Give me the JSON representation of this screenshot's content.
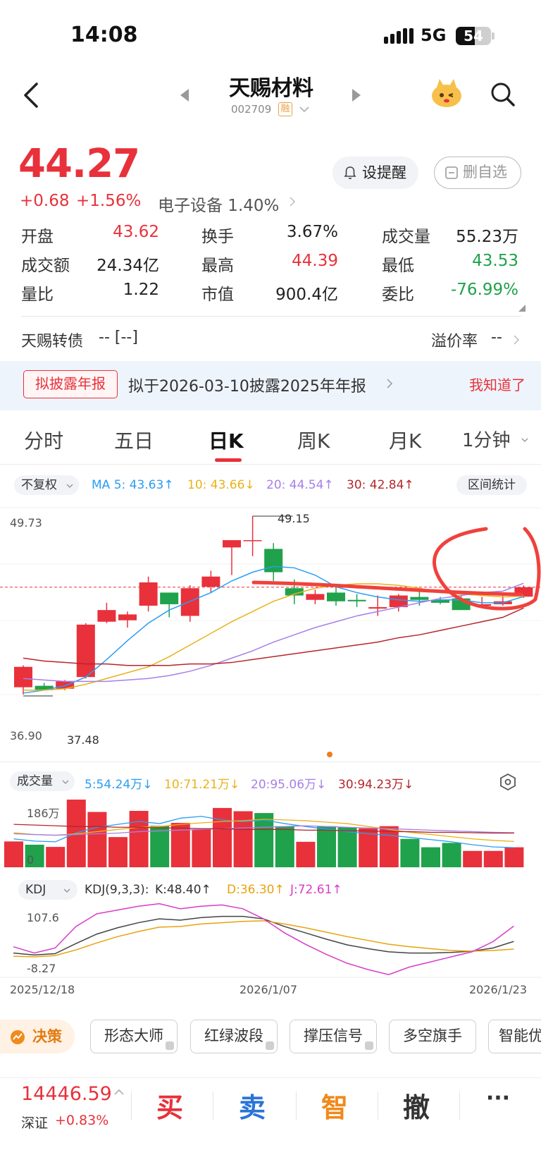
{
  "status_bar": {
    "time": "14:08",
    "network": "5G",
    "battery": "54",
    "battery_level": 0.54
  },
  "nav": {
    "stock_name": "天赐材料",
    "stock_code": "002709",
    "margin_badge": "融"
  },
  "quote": {
    "price": "44.27",
    "change_abs": "+0.68",
    "change_pct": "+1.56%",
    "sector": "电子设备 1.40%",
    "alert_label": "设提醒",
    "watchlist_label": "删自选"
  },
  "stats": [
    {
      "label": "开盘",
      "value": "43.62",
      "color": "#e8313b"
    },
    {
      "label": "换手",
      "value": "3.67%",
      "color": "#222222"
    },
    {
      "label": "成交量",
      "value": "55.23万",
      "color": "#222222"
    },
    {
      "label": "成交额",
      "value": "24.34亿",
      "color": "#222222"
    },
    {
      "label": "最高",
      "value": "44.39",
      "color": "#e8313b"
    },
    {
      "label": "最低",
      "value": "43.53",
      "color": "#1fa24b"
    },
    {
      "label": "量比",
      "value": "1.22",
      "color": "#222222"
    },
    {
      "label": "市值",
      "value": "900.4亿",
      "color": "#222222"
    },
    {
      "label": "委比",
      "value": "-76.99%",
      "color": "#1fa24b"
    }
  ],
  "convertible": {
    "label": "天赐转债",
    "value": "--   [--]",
    "premium_label": "溢价率",
    "premium_value": "--"
  },
  "banner": {
    "tag": "拟披露年报",
    "text": "拟于2026-03-10披露2025年年报",
    "dismiss": "我知道了"
  },
  "tabs": [
    "分时",
    "五日",
    "日K",
    "周K",
    "月K",
    "1分钟"
  ],
  "active_tab": "日K",
  "ma_row": {
    "adjust": "不复权",
    "ma5": "MA 5: 43.63↑",
    "ma10": "10: 43.66↓",
    "ma20": "20: 44.54↑",
    "ma30": "30: 42.84↑",
    "range_stats": "区间统计"
  },
  "kline": {
    "y_top_label": "49.73",
    "y_bottom_label": "36.90",
    "high_marker": "49.15",
    "low_marker": "37.48"
  },
  "volume": {
    "selector": "成交量",
    "ma5": "5:54.24万↓",
    "ma10": "10:71.21万↓",
    "ma20": "20:95.06万↓",
    "ma30": "30:94.23万↓",
    "y_top": "186万",
    "y_bottom": "0"
  },
  "kdj": {
    "selector": "KDJ",
    "params": "KDJ(9,3,3):",
    "k": "K:48.40↑",
    "d": "D:36.30↑",
    "j": "J:72.61↑",
    "y_top": "107.6",
    "y_bottom": "-8.27"
  },
  "dates": [
    "2025/12/18",
    "2026/1/07",
    "2026/1/23"
  ],
  "tools": {
    "strategy": "决策",
    "items": [
      "形态大师",
      "红绿波段",
      "撑压信号",
      "多空旗手",
      "智能优"
    ]
  },
  "bottom": {
    "index_value": "14446.59",
    "index_name": "深证",
    "index_change": "+0.83%",
    "buy": "买",
    "sell": "卖",
    "smart": "智",
    "cancel": "撤",
    "more": "···"
  },
  "colors": {
    "up": "#e8313b",
    "down": "#1fa24b",
    "ma5": "#2a9df4",
    "ma10": "#e8b21a",
    "ma20": "#a77fe8",
    "ma30": "#b5262c"
  },
  "candles": [
    {
      "o": 37.4,
      "h": 38.9,
      "l": 36.9,
      "c": 38.8
    },
    {
      "o": 37.5,
      "h": 37.7,
      "l": 37.2,
      "c": 37.2
    },
    {
      "o": 37.3,
      "h": 37.9,
      "l": 37.2,
      "c": 37.8
    },
    {
      "o": 38.1,
      "h": 41.8,
      "l": 38.0,
      "c": 41.7
    },
    {
      "o": 41.9,
      "h": 43.2,
      "l": 41.8,
      "c": 42.7
    },
    {
      "o": 42.0,
      "h": 42.6,
      "l": 41.5,
      "c": 42.4
    },
    {
      "o": 43.0,
      "h": 45.0,
      "l": 42.6,
      "c": 44.6
    },
    {
      "o": 43.9,
      "h": 43.9,
      "l": 42.2,
      "c": 43.1
    },
    {
      "o": 42.3,
      "h": 44.4,
      "l": 41.9,
      "c": 44.2
    },
    {
      "o": 44.3,
      "h": 45.4,
      "l": 43.9,
      "c": 45.0
    },
    {
      "o": 47.0,
      "h": 47.4,
      "l": 45.1,
      "c": 47.5
    },
    {
      "o": 47.5,
      "h": 49.15,
      "l": 46.4,
      "c": 47.5
    },
    {
      "o": 46.9,
      "h": 47.3,
      "l": 44.7,
      "c": 45.3
    },
    {
      "o": 44.2,
      "h": 44.8,
      "l": 43.1,
      "c": 43.7
    },
    {
      "o": 43.4,
      "h": 44.1,
      "l": 43.1,
      "c": 43.8
    },
    {
      "o": 43.9,
      "h": 44.3,
      "l": 43.0,
      "c": 43.3
    },
    {
      "o": 43.4,
      "h": 43.8,
      "l": 42.9,
      "c": 43.3
    },
    {
      "o": 42.8,
      "h": 43.7,
      "l": 42.3,
      "c": 42.9
    },
    {
      "o": 42.9,
      "h": 43.8,
      "l": 42.6,
      "c": 43.7
    },
    {
      "o": 43.6,
      "h": 44.0,
      "l": 43.0,
      "c": 43.4
    },
    {
      "o": 43.4,
      "h": 43.6,
      "l": 43.1,
      "c": 43.2
    },
    {
      "o": 43.5,
      "h": 43.7,
      "l": 42.7,
      "c": 42.7
    },
    {
      "o": 43.0,
      "h": 43.6,
      "l": 42.9,
      "c": 43.1
    },
    {
      "o": 43.1,
      "h": 43.9,
      "l": 43.0,
      "c": 43.3
    },
    {
      "o": 43.62,
      "h": 44.39,
      "l": 43.53,
      "c": 44.27
    }
  ],
  "ma_lines": {
    "ma5": [
      37.0,
      37.2,
      37.5,
      38.1,
      39.3,
      40.6,
      41.8,
      42.7,
      43.3,
      43.9,
      44.7,
      45.3,
      45.7,
      45.6,
      45.1,
      44.3,
      43.9,
      43.6,
      43.4,
      43.3,
      43.4,
      43.4,
      43.2,
      43.2,
      43.63
    ],
    "ma10": [
      37.2,
      37.2,
      37.3,
      37.6,
      38.0,
      38.4,
      38.8,
      39.5,
      40.3,
      41.1,
      41.9,
      42.6,
      43.3,
      43.8,
      44.2,
      44.4,
      44.5,
      44.5,
      44.4,
      44.2,
      43.9,
      43.8,
      43.7,
      43.6,
      43.66
    ],
    "ma20": [
      38.0,
      37.9,
      37.8,
      37.8,
      37.8,
      37.9,
      38.0,
      38.2,
      38.5,
      38.9,
      39.4,
      39.9,
      40.5,
      41.0,
      41.5,
      41.9,
      42.3,
      42.6,
      42.9,
      43.2,
      43.5,
      43.7,
      43.9,
      44.0,
      44.54
    ],
    "ma30": [
      39.4,
      39.2,
      39.1,
      39.0,
      39.0,
      38.9,
      38.9,
      38.9,
      39.0,
      39.0,
      39.1,
      39.3,
      39.5,
      39.7,
      39.9,
      40.1,
      40.3,
      40.5,
      40.8,
      41.0,
      41.3,
      41.6,
      41.9,
      42.2,
      42.84
    ]
  },
  "volumes": [
    71,
    62,
    56,
    186,
    152,
    83,
    155,
    114,
    122,
    104,
    163,
    154,
    149,
    113,
    70,
    113,
    110,
    107,
    113,
    78,
    55,
    67,
    45,
    45,
    55
  ],
  "vol_ma_lines": {
    "ma5": [
      78,
      72,
      70,
      95,
      110,
      118,
      126,
      120,
      135,
      140,
      130,
      125,
      130,
      120,
      112,
      105,
      98,
      92,
      88,
      82,
      76,
      70,
      62,
      56,
      54
    ],
    "ma10": [
      95,
      90,
      88,
      92,
      98,
      104,
      110,
      112,
      118,
      122,
      126,
      128,
      132,
      130,
      128,
      124,
      120,
      112,
      104,
      96,
      90,
      84,
      78,
      74,
      71
    ],
    "ma20": [
      92,
      90,
      88,
      90,
      92,
      94,
      98,
      100,
      102,
      104,
      106,
      108,
      110,
      112,
      114,
      112,
      110,
      108,
      106,
      104,
      102,
      100,
      98,
      96,
      95
    ],
    "ma30": [
      118,
      116,
      114,
      112,
      112,
      110,
      110,
      108,
      108,
      106,
      106,
      104,
      104,
      104,
      102,
      102,
      100,
      100,
      98,
      98,
      96,
      96,
      95,
      94,
      94
    ]
  },
  "kdj_lines": {
    "k": [
      30,
      27,
      29,
      45,
      60,
      70,
      78,
      84,
      82,
      86,
      88,
      88,
      84,
      72,
      62,
      52,
      43,
      37,
      32,
      30,
      30,
      31,
      33,
      38,
      48.4
    ],
    "d": [
      25,
      24,
      26,
      35,
      46,
      56,
      64,
      71,
      72,
      76,
      78,
      80,
      81,
      76,
      70,
      63,
      56,
      50,
      44,
      40,
      37,
      34,
      33,
      34,
      36.3
    ],
    "j": [
      40,
      30,
      38,
      72,
      92,
      98,
      104,
      108,
      100,
      104,
      106,
      100,
      84,
      62,
      44,
      28,
      14,
      4,
      -4,
      8,
      16,
      24,
      32,
      48,
      72.61
    ]
  }
}
